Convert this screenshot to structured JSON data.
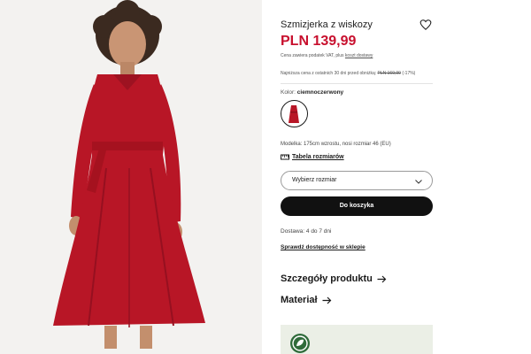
{
  "product": {
    "title": "Szmizjerka z wiskozy",
    "price": "PLN 139,99",
    "vat_text": "Cena zawiera podatek VAT, plus",
    "vat_link": "koszt dostawy",
    "lowest_price_text": "Najniższa cena z ostatnich 30 dni przed obniżką:",
    "lowest_price_value": "PLN 169,99",
    "lowest_price_discount": "(-17%)",
    "color_label": "Kolor:",
    "color_name": "ciemnoczerwony",
    "model_info": "Modelka: 175cm wzrostu, nosi rozmiar 46 (EU)",
    "size_chart_label": "Tabela rozmiarów",
    "size_select_label": "Wybierz rozmiar",
    "add_to_cart_label": "Do koszyka",
    "delivery_text": "Dostawa: 4 do 7 dni",
    "store_availability_label": "Sprawdź dostępność w sklepie",
    "details_label": "Szczegóły produktu",
    "material_label": "Materiał"
  },
  "colors": {
    "accent_price": "#c8102e",
    "dress": "#b81626",
    "button": "#111111",
    "promo_bg": "#ebefe6"
  },
  "icons": {
    "wishlist": "heart-icon",
    "size_chart": "ruler-icon",
    "select": "chevron-down-icon",
    "details": "arrow-right-icon",
    "material": "arrow-right-icon",
    "promo": "eco-badge-icon"
  }
}
